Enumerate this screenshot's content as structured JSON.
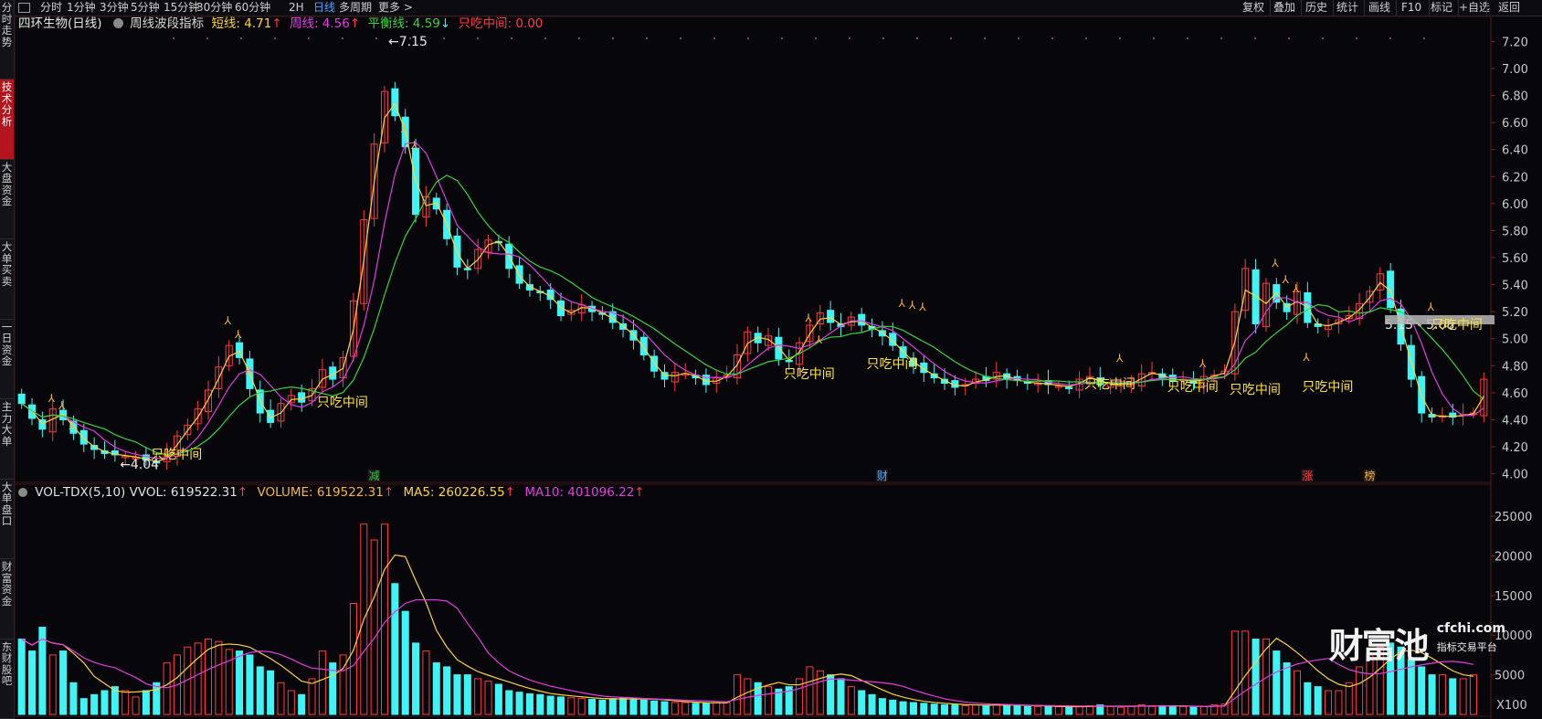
{
  "sidebar": [
    "分时走势",
    "技术分析",
    "大盘资金",
    "大单买卖",
    "一日资金",
    "主力大单",
    "大单盘口",
    "财富资金",
    "东财股吧"
  ],
  "topbar": {
    "left": [
      "分时",
      "1分钟",
      "3分钟",
      "5分钟",
      "15分钟",
      "30分钟",
      "60分钟",
      "2H",
      "日线",
      "多周期",
      "更多 >"
    ],
    "right": [
      "复权",
      "叠加",
      "历史",
      "统计",
      "画线",
      "F10",
      "标记",
      "+自选",
      "返回"
    ],
    "active": "日线"
  },
  "header": {
    "stock": "四环生物(日线)",
    "indicator": "周线波段指标",
    "short": "短线: 4.71",
    "week": "周线: 4.56",
    "balance": "平衡线: 4.59",
    "only_mid": "只吃中间: 0.00"
  },
  "vol_header": {
    "name": "VOL-TDX(5,10)",
    "vvol": "VVOL: 619522.31",
    "volume": "VOLUME: 619522.31",
    "ma5": "MA5: 260226.55",
    "ma10": "MA10: 401096.22"
  },
  "colors": {
    "up": "#ff3b3b",
    "down": "#3ff4f4",
    "short": "#ffd33a",
    "week": "#e23ce2",
    "balance": "#37d53a",
    "grid": "#2a1010"
  },
  "annotations": {
    "high": "7.15",
    "low": "4.04",
    "range": "5.15 - 5.08",
    "zhichi": "只吃中间",
    "marks": [
      "减",
      "财",
      "涨",
      "榜"
    ],
    "vol_unit": "X100"
  },
  "price_axis": [
    "7.20",
    "7.00",
    "6.80",
    "6.60",
    "6.40",
    "6.20",
    "6.00",
    "5.80",
    "5.60",
    "5.40",
    "5.20",
    "5.00",
    "4.80",
    "4.60",
    "4.40",
    "4.20",
    "4.00"
  ],
  "vol_axis": [
    "25000",
    "20000",
    "15000",
    "10000",
    "5000"
  ],
  "watermark": {
    "main": "财富池",
    "url": "cfchi.com",
    "sub": "指标交易平台"
  },
  "chart_data": {
    "type": "candlestick",
    "price_range": [
      3.95,
      7.25
    ],
    "volume_range": [
      0,
      26500
    ],
    "closes": [
      4.52,
      4.41,
      4.33,
      4.48,
      4.4,
      4.3,
      4.22,
      4.18,
      4.15,
      4.14,
      4.13,
      4.12,
      4.1,
      4.08,
      4.15,
      4.28,
      4.36,
      4.48,
      4.62,
      4.79,
      4.95,
      4.86,
      4.63,
      4.45,
      4.38,
      4.52,
      4.58,
      4.53,
      4.63,
      4.77,
      4.7,
      4.86,
      5.28,
      5.88,
      6.44,
      6.83,
      6.65,
      6.42,
      5.92,
      6.05,
      5.96,
      5.74,
      5.53,
      5.51,
      5.66,
      5.73,
      5.71,
      5.52,
      5.41,
      5.36,
      5.34,
      5.29,
      5.17,
      5.21,
      5.25,
      5.2,
      5.18,
      5.12,
      5.07,
      4.99,
      4.88,
      4.76,
      4.7,
      4.75,
      4.74,
      4.71,
      4.66,
      4.71,
      4.73,
      4.88,
      5.05,
      4.97,
      5.02,
      4.85,
      4.83,
      4.97,
      5.1,
      5.19,
      5.12,
      5.09,
      5.16,
      5.1,
      5.07,
      5.02,
      4.95,
      4.86,
      4.8,
      4.75,
      4.71,
      4.67,
      4.64,
      4.66,
      4.7,
      4.69,
      4.75,
      4.7,
      4.69,
      4.67,
      4.67,
      4.66,
      4.65,
      4.64,
      4.7,
      4.72,
      4.66,
      4.67,
      4.66,
      4.67,
      4.74,
      4.75,
      4.71,
      4.69,
      4.7,
      4.67,
      4.72,
      4.73,
      4.76,
      5.2,
      5.52,
      5.11,
      5.41,
      5.27,
      5.2,
      5.35,
      5.12,
      5.09,
      5.1,
      5.14,
      5.17,
      5.26,
      5.35,
      5.48,
      5.23,
      4.96,
      4.7,
      4.45,
      4.42,
      4.43,
      4.42,
      4.44,
      4.45,
      4.7
    ],
    "volumes": [
      9500,
      8000,
      11000,
      7500,
      8000,
      4000,
      2000,
      2500,
      3000,
      3500,
      3000,
      2200,
      3000,
      4000,
      6500,
      7500,
      8500,
      9000,
      9500,
      9200,
      8200,
      8000,
      7500,
      6000,
      5500,
      4000,
      3000,
      2500,
      4500,
      8000,
      6500,
      7500,
      14000,
      24000,
      22000,
      24000,
      16500,
      13000,
      9000,
      8000,
      6500,
      6000,
      5000,
      5000,
      4500,
      4200,
      3800,
      3000,
      2800,
      2600,
      2500,
      2300,
      2200,
      2100,
      2000,
      1900,
      1800,
      2000,
      2100,
      2000,
      1800,
      1700,
      1600,
      1500,
      1500,
      1400,
      1400,
      1500,
      1500,
      5000,
      4500,
      4000,
      3500,
      3200,
      3500,
      4500,
      6000,
      5500,
      5000,
      4500,
      3500,
      3000,
      2500,
      2000,
      1800,
      1600,
      1500,
      1400,
      1300,
      1200,
      1200,
      1100,
      1200,
      1100,
      1300,
      1200,
      1100,
      1000,
      1000,
      1000,
      1000,
      900,
      1000,
      1100,
      1200,
      1000,
      900,
      1000,
      1200,
      1100,
      1100,
      1000,
      1000,
      900,
      1000,
      1200,
      1300,
      10500,
      10500,
      9500,
      9500,
      8000,
      6500,
      5500,
      4000,
      3500,
      3000,
      3000,
      4000,
      6000,
      7500,
      8500,
      9000,
      8500,
      7000,
      6000,
      5000,
      5000,
      4500,
      4500,
      5000
    ]
  }
}
